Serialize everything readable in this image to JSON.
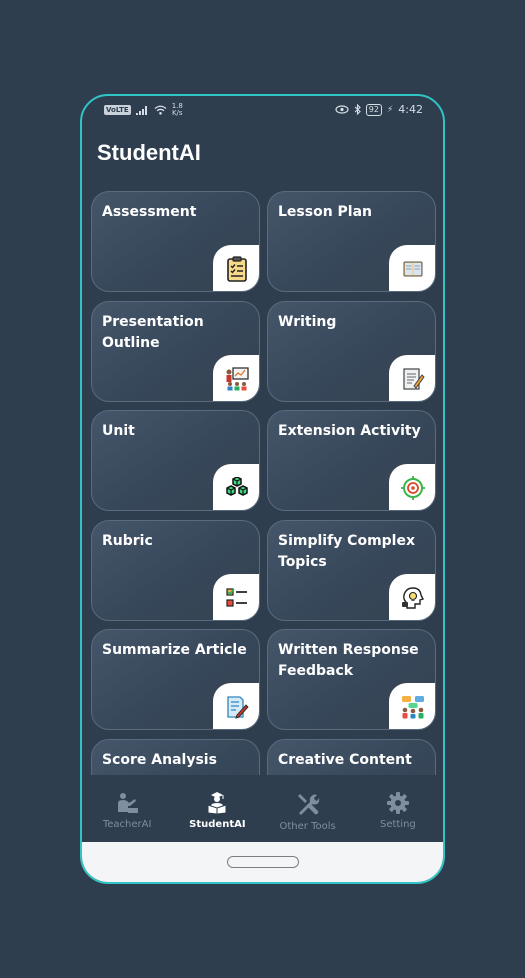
{
  "status_bar": {
    "network": "VoLTE",
    "speed_value": "1.8",
    "speed_unit": "K/s",
    "battery": "92",
    "time": "4:42"
  },
  "app": {
    "title": "StudentAI"
  },
  "cards": [
    {
      "label": "Assessment",
      "icon": "clipboard-checklist-icon"
    },
    {
      "label": "Lesson Plan",
      "icon": "open-book-icon"
    },
    {
      "label": "Presentation Outline",
      "icon": "presentation-board-icon"
    },
    {
      "label": "Writing",
      "icon": "writing-paper-pen-icon"
    },
    {
      "label": "Unit",
      "icon": "stacked-cubes-icon"
    },
    {
      "label": "Extension Activity",
      "icon": "target-icon"
    },
    {
      "label": "Rubric",
      "icon": "checklist-icon"
    },
    {
      "label": "Simplify Complex Topics",
      "icon": "head-lightbulb-icon"
    },
    {
      "label": "Summarize Article",
      "icon": "document-pencil-icon"
    },
    {
      "label": "Written Response Feedback",
      "icon": "feedback-chat-icon"
    },
    {
      "label": "Score Analysis",
      "icon": ""
    },
    {
      "label": "Creative Content",
      "icon": ""
    }
  ],
  "nav": {
    "items": [
      {
        "label": "TeacherAI",
        "icon": "teacher-icon",
        "active": false
      },
      {
        "label": "StudentAI",
        "icon": "student-reading-icon",
        "active": true
      },
      {
        "label": "Other Tools",
        "icon": "tools-icon",
        "active": false
      },
      {
        "label": "Setting",
        "icon": "gear-icon",
        "active": false
      }
    ]
  },
  "colors": {
    "background": "#2e3e4f",
    "frame_accent": "#30c4c4",
    "card_label": "#ffffff",
    "nav_inactive": "#7f8e9e",
    "nav_active": "#ffffff"
  }
}
